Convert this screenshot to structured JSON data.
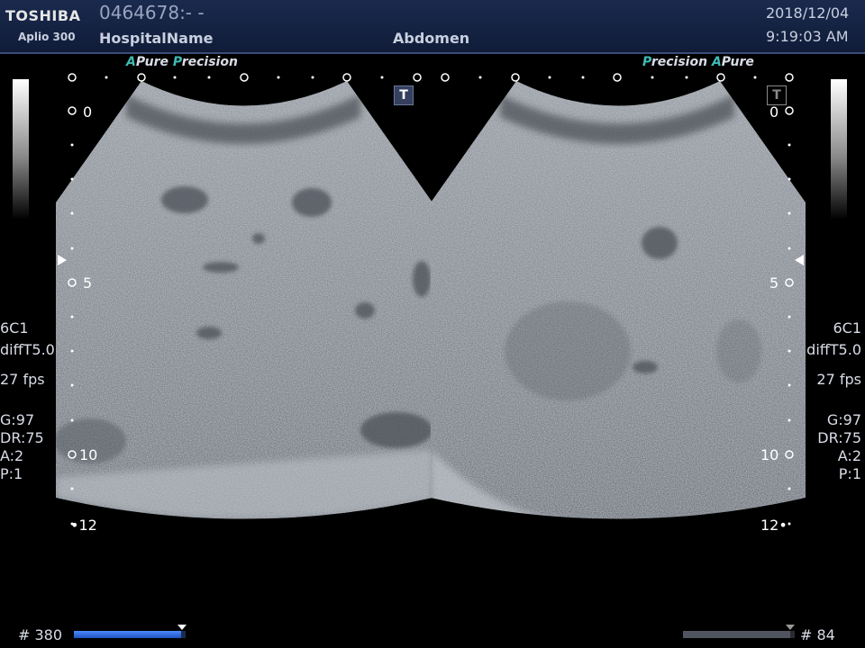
{
  "header": {
    "brand": "TOSHIBA",
    "model": "Aplio 300",
    "patient_id": "0464678:- -",
    "hospital": "HospitalName",
    "exam": "Abdomen",
    "date": "2018/12/04",
    "time": "9:19:03 AM"
  },
  "left": {
    "precision_a": "A",
    "precision_pure": "Pure",
    "precision_p": "P",
    "precision_rest": "recision",
    "depth_0": "0",
    "depth_5": "5",
    "depth_10": "10",
    "depth_12": "12",
    "probe": "6C1",
    "mode": "diffT5.0",
    "fps": "27 fps",
    "gain": "G:97",
    "dr": "DR:75",
    "a": "A:2",
    "p": "P:1",
    "frame": "# 380",
    "progress": 0.96
  },
  "right": {
    "precision_p": "P",
    "precision_rest": "recision",
    "precision_a": "A",
    "precision_pure": "Pure",
    "depth_0": "0",
    "depth_5": "5",
    "depth_10": "10",
    "depth_12": "12",
    "probe": "6C1",
    "mode": "diffT5.0",
    "fps": "27 fps",
    "gain": "G:97",
    "dr": "DR:75",
    "a": "A:2",
    "p": "P:1",
    "frame": "# 84",
    "progress": 0.96
  },
  "t_label": "T",
  "colors": {
    "header_bg": "#15244a",
    "accent": "#3fbab3",
    "progress_active": "#2f6fd6",
    "progress_inactive": "#50545e"
  }
}
